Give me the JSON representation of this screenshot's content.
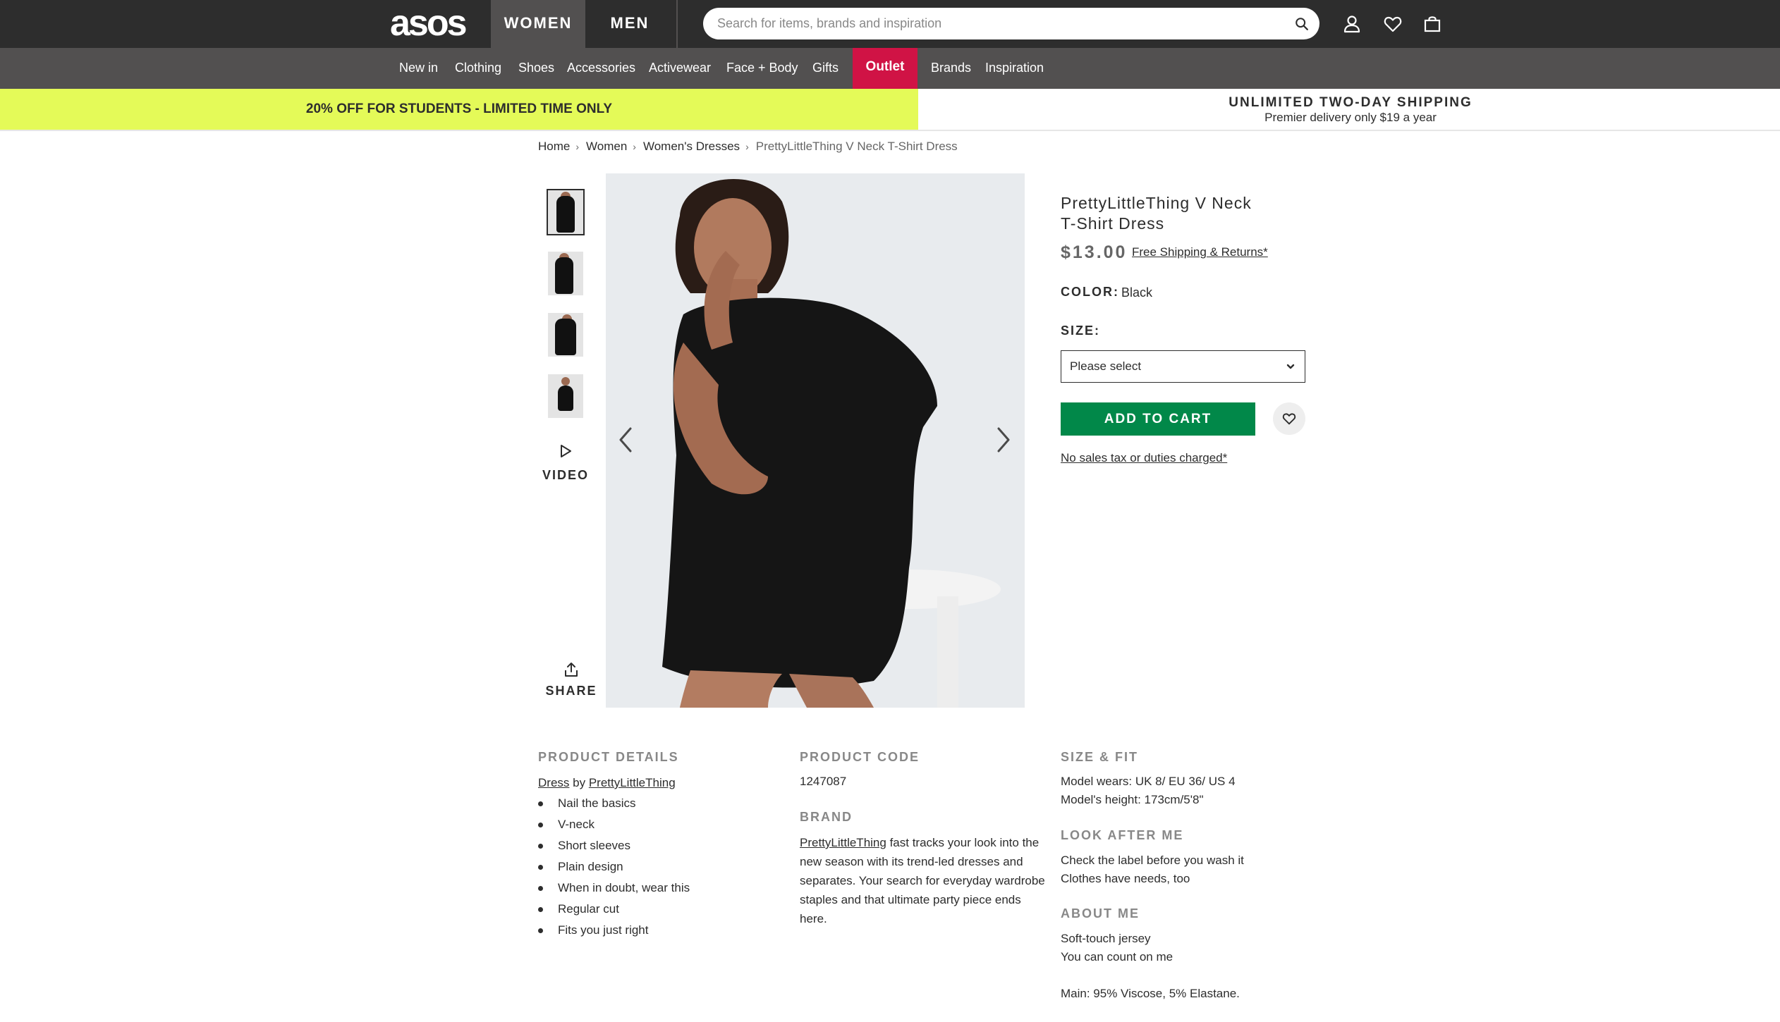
{
  "header": {
    "logo": "asos",
    "tabs": [
      {
        "label": "WOMEN",
        "active": true
      },
      {
        "label": "MEN",
        "active": false
      }
    ],
    "search_placeholder": "Search for items, brands and inspiration",
    "icons": [
      "account-icon",
      "saved-items-heart-icon",
      "bag-icon"
    ]
  },
  "nav": {
    "items": [
      "New in",
      "Clothing",
      "Shoes",
      "Accessories",
      "Activewear",
      "Face + Body",
      "Gifts",
      "Outlet",
      "Brands",
      "Inspiration"
    ],
    "outlet_color": "#d01345"
  },
  "promo": {
    "left": "20% OFF FOR STUDENTS - LIMITED TIME ONLY",
    "left_color": "#e4fa58",
    "right_title": "UNLIMITED TWO-DAY SHIPPING",
    "right_subtitle": "Premier delivery only $19 a year"
  },
  "breadcrumb": [
    "Home",
    "Women",
    "Women's Dresses",
    "PrettyLittleThing V Neck T-Shirt Dress"
  ],
  "gallery": {
    "video_label": "VIDEO",
    "share_label": "SHARE"
  },
  "product": {
    "title": "PrettyLittleThing V Neck T-Shirt Dress",
    "price": "$13.00",
    "shipping_link": "Free Shipping & Returns*",
    "color_label": "COLOR:",
    "color_value": "Black",
    "size_label": "SIZE:",
    "size_value": "Please select",
    "add_to_cart": "ADD TO CART",
    "add_to_cart_color": "#018849",
    "tax_note": "No sales tax or duties charged*"
  },
  "details": {
    "product_details_heading": "PRODUCT DETAILS",
    "category_link": "Dress",
    "by_text": " by ",
    "brand_link": "PrettyLittleThing",
    "bullets": [
      "Nail the basics",
      "V-neck",
      "Short sleeves",
      "Plain design",
      "When in doubt, wear this",
      "Regular cut",
      "Fits you just right"
    ],
    "product_code_heading": "PRODUCT CODE",
    "product_code": "1247087",
    "brand_heading": "BRAND",
    "brand_text": " fast tracks your look into the new season with its trend-led dresses and separates. Your search for everyday wardrobe staples and that ultimate party piece ends here.",
    "size_fit_heading": "SIZE & FIT",
    "size_fit_lines": [
      "Model wears: UK 8/ EU 36/ US 4",
      "Model's height: 173cm/5'8\""
    ],
    "look_after_heading": "LOOK AFTER ME",
    "look_after_lines": [
      "Check the label before you wash it",
      "Clothes have needs, too"
    ],
    "about_heading": "ABOUT ME",
    "about_lines": [
      "Soft-touch jersey",
      "You can count on me"
    ],
    "composition": "Main: 95% Viscose, 5% Elastane."
  }
}
